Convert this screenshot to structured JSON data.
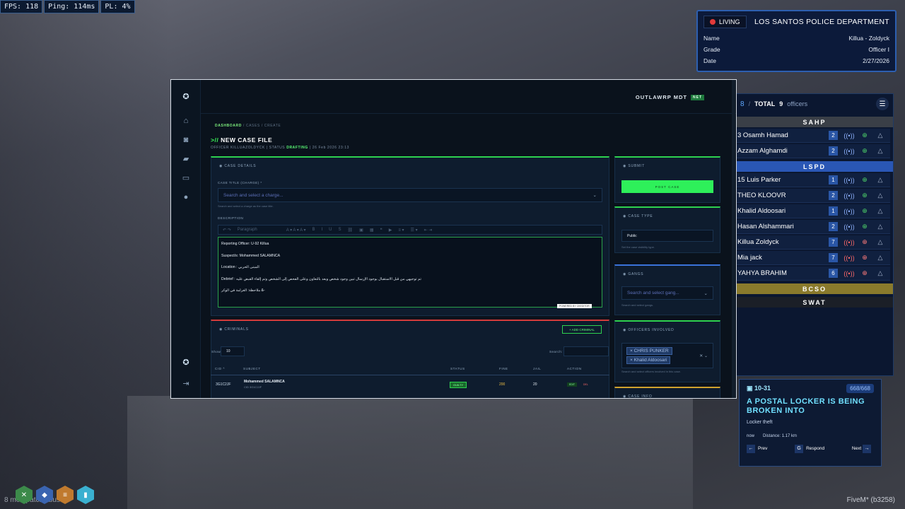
{
  "hud": {
    "fps": "FPS: 118",
    "ping": "Ping: 114ms",
    "pl": "PL: 4%"
  },
  "id_card": {
    "status": "LIVING",
    "department": "LOS SANTOS POLICE DEPARTMENT",
    "rows": [
      {
        "label": "Name",
        "value": "Killua - Zoldyck"
      },
      {
        "label": "Grade",
        "value": "Officer I"
      },
      {
        "label": "Date",
        "value": "2/27/2026"
      }
    ]
  },
  "roster": {
    "online": "8",
    "sep": "/",
    "total_label": "TOTAL",
    "total": "9",
    "unit": "officers",
    "sections": [
      {
        "name": "SAHP",
        "color": "#3a3f47",
        "officers": [
          {
            "name": "3 Osamh Hamad",
            "count": "2",
            "alert": "#8fb3ff"
          },
          {
            "name": "Azzam Alghamdi",
            "count": "2",
            "alert": "#8fb3ff"
          }
        ]
      },
      {
        "name": "LSPD",
        "color": "#2a57b5",
        "officers": [
          {
            "name": "15 Luis Parker",
            "count": "1",
            "alert": "#8fb3ff"
          },
          {
            "name": "THEO KLOOVR",
            "count": "2",
            "alert": "#8fb3ff"
          },
          {
            "name": "Khalid Aldoosari",
            "count": "1",
            "alert": "#8fb3ff"
          },
          {
            "name": "Hasan Alshammari",
            "count": "2",
            "alert": "#8fb3ff"
          },
          {
            "name": "Killua Zoldyck",
            "count": "7",
            "alert": "#ff6a6a"
          },
          {
            "name": "Mia jack",
            "count": "7",
            "alert": "#ff6a6a"
          },
          {
            "name": "YAHYA BRAHIM",
            "count": "6",
            "alert": "#ff6a6a"
          }
        ]
      },
      {
        "name": "BCSO",
        "color": "#8a7a2c",
        "officers": []
      },
      {
        "name": "SWAT",
        "color": "#1b1f27",
        "officers": []
      }
    ]
  },
  "dispatch": {
    "code": "10-31",
    "counter": "668/668",
    "title": "A POSTAL LOCKER IS BEING BROKEN INTO",
    "subtitle": "Locker theft",
    "time": "now",
    "distance": "Distance: 1.17 km",
    "prev": "Prev",
    "respond_key": "G",
    "respond": "Respond",
    "next": "Next"
  },
  "bottom": {
    "text": "8 mod  patch kbus",
    "fivem": "FiveM* (b3258)"
  },
  "mdt": {
    "brand": "OUTLAWRP MDT",
    "brand_tag": "NET",
    "crumb_home": "DASHBOARD",
    "crumb_rest": "/ CASES / CREATE",
    "title_prefix": ">//",
    "title": "NEW CASE FILE",
    "meta_officer": "OFFICER  KILLUAZOLDYCK  |  STATUS",
    "meta_status": "DRAFTING",
    "meta_date": "|  26 Feb 2026 23:13",
    "case_details": "CASE DETAILS",
    "case_title_label": "CASE TITLE (CHARGE) *",
    "charge_placeholder": "Search and select a charge...",
    "charge_hint": "Search and select a charge as the case title.",
    "description_label": "DESCRIPTION",
    "paragraph": "Paragraph",
    "editor_lines": [
      "Reporting Officer: U-92 Killua",
      "Suspect/s: Mohammed SALAMNCA",
      "Location : المبنى الحربي",
      "Debrief : تم توجيهي من قبل الاستقبال بوجود الإرسال تبين وجود شخص وبعد بالتعاون وعلى الفحص إلى الشخص وتم إلقاء القبض عليه",
      "ملاحظة: الغرامة في الوكر &-"
    ],
    "ck_badge": "POWERED BY CKEDITOR",
    "submit": "SUBMIT",
    "post_case": "POST CASE",
    "case_type": "CASE TYPE",
    "case_type_value": "Public",
    "case_type_hint": "Set the case visibility type.",
    "gangs": "GANGS",
    "gang_placeholder": "Search and select gang...",
    "gang_hint": "Search and select gangs.",
    "officers_involved": "OFFICERS INVOLVED",
    "officers": [
      "CHRIS PUNKER",
      "Khalid Aldoosari"
    ],
    "officers_hint": "Search and select officers involved in this case.",
    "case_info": "CASE INFO",
    "criminals": "CRIMINALS",
    "add_criminal": "+ ADD CRIMINAL",
    "show_label": "Show",
    "show_value": "10",
    "search_label": "Search:",
    "columns": [
      "CID ^",
      "SUBJECT",
      "STATUS",
      "FINE",
      "JAIL",
      "ACTION"
    ],
    "rows": [
      {
        "cid": "3G1C2JF",
        "subject": "Mohammed SALAMNCA",
        "sub_cid": "CID 3G1C2JF",
        "status": "GUILTY",
        "fine": "200",
        "jail": "20",
        "edit": "EDIT",
        "del": "DEL"
      }
    ]
  }
}
